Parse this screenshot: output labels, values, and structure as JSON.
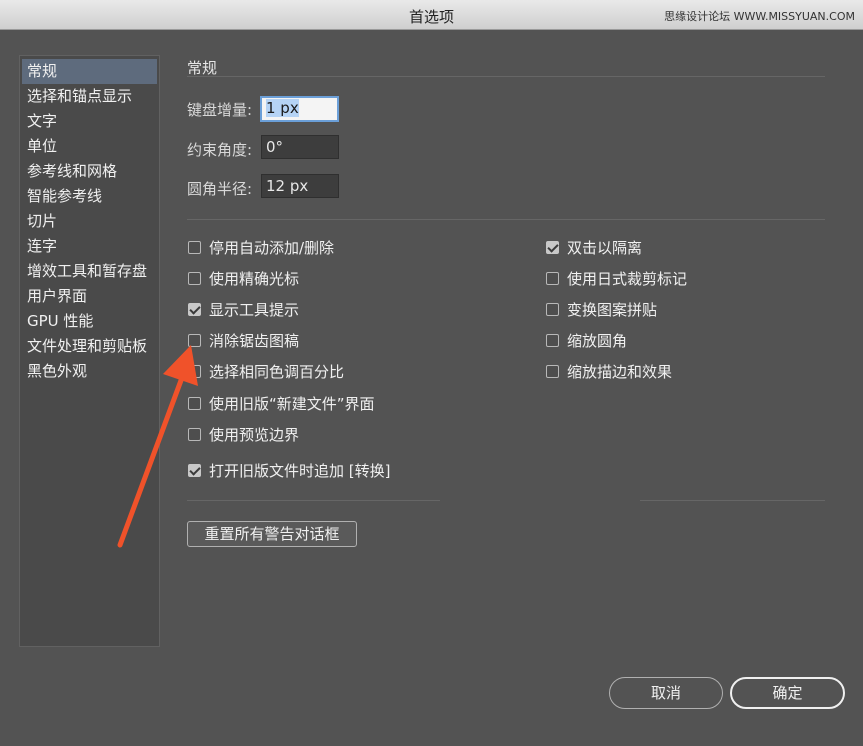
{
  "window": {
    "title": "首选项",
    "watermark": "思缘设计论坛 WWW.MISSYUAN.COM"
  },
  "sidebar": {
    "items": [
      {
        "label": "常规",
        "active": true
      },
      {
        "label": "选择和锚点显示"
      },
      {
        "label": "文字"
      },
      {
        "label": "单位"
      },
      {
        "label": "参考线和网格"
      },
      {
        "label": "智能参考线"
      },
      {
        "label": "切片"
      },
      {
        "label": "连字"
      },
      {
        "label": "增效工具和暂存盘"
      },
      {
        "label": "用户界面"
      },
      {
        "label": "GPU 性能"
      },
      {
        "label": "文件处理和剪贴板"
      },
      {
        "label": "黑色外观"
      }
    ]
  },
  "main": {
    "section_title": "常规",
    "fields": {
      "keyboard_increment": {
        "label": "键盘增量:",
        "value": "1 px"
      },
      "constrain_angle": {
        "label": "约束角度:",
        "value": "0°"
      },
      "corner_radius": {
        "label": "圆角半径:",
        "value": "12 px"
      }
    },
    "left_checks": [
      {
        "label": "停用自动添加/删除",
        "checked": false
      },
      {
        "label": "使用精确光标",
        "checked": false
      },
      {
        "label": "显示工具提示",
        "checked": true
      },
      {
        "label": "消除锯齿图稿",
        "checked": false
      },
      {
        "label": "选择相同色调百分比",
        "checked": false
      },
      {
        "label": "使用旧版“新建文件”界面",
        "checked": false
      },
      {
        "label": "使用预览边界",
        "checked": false
      }
    ],
    "right_checks": [
      {
        "label": "双击以隔离",
        "checked": true
      },
      {
        "label": "使用日式裁剪标记",
        "checked": false
      },
      {
        "label": "变换图案拼贴",
        "checked": false
      },
      {
        "label": "缩放圆角",
        "checked": false
      },
      {
        "label": "缩放描边和效果",
        "checked": false
      }
    ],
    "legacy_check": {
      "label": "打开旧版文件时追加 [转换]",
      "checked": true
    },
    "reset_button": "重置所有警告对话框"
  },
  "footer": {
    "cancel": "取消",
    "ok": "确定"
  },
  "colors": {
    "background": "#535353",
    "selection": "#5e6b7d",
    "arrow": "#f0522a"
  }
}
